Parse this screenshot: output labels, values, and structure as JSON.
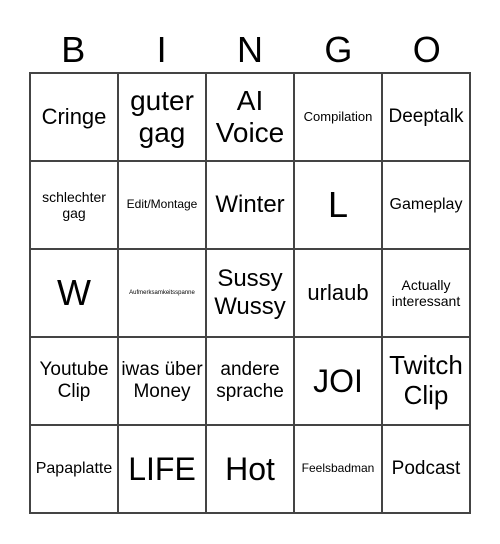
{
  "header": [
    "B",
    "I",
    "N",
    "G",
    "O"
  ],
  "cells": [
    "Cringe",
    "guter gag",
    "AI Voice",
    "Compilation",
    "Deeptalk",
    "schlechter gag",
    "Edit/Montage",
    "Winter",
    "L",
    "Gameplay",
    "W",
    "Aufmerksamkeitsspanne",
    "Sussy Wussy",
    "urlaub",
    "Actually interessant",
    "Youtube Clip",
    "iwas über Money",
    "andere sprache",
    "JOI",
    "Twitch Clip",
    "Papaplatte",
    "LIFE",
    "Hot",
    "Feelsbadman",
    "Podcast"
  ]
}
